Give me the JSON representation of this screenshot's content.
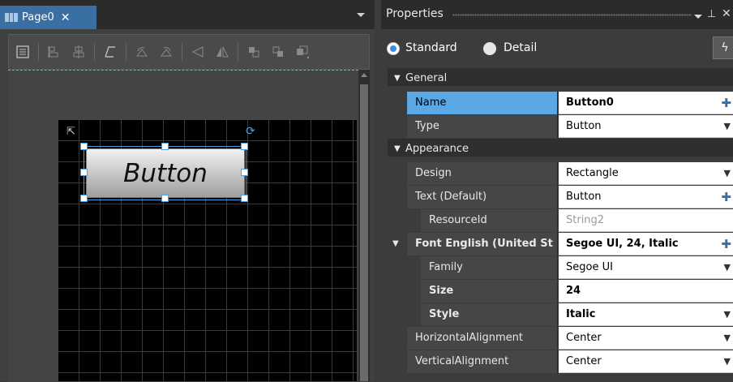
{
  "document_tab": {
    "label": "Page0",
    "close": "✕"
  },
  "toolbar_icons": [
    "page-properties-icon",
    "align-left-icon",
    "align-center-icon",
    "skew-icon",
    "rotate-left-icon",
    "rotate-right-icon",
    "flip-horizontal-icon",
    "flip-vertical-icon",
    "bring-forward-icon",
    "send-backward-icon",
    "bring-to-front-icon"
  ],
  "canvas": {
    "button_text": "Button"
  },
  "properties": {
    "title": "Properties",
    "pin": "ꟷ",
    "close": "✕",
    "mode": {
      "standard": "Standard",
      "detail": "Detail",
      "selected": "standard"
    },
    "lightning": "ϟ",
    "rows": [
      {
        "kind": "category",
        "label": "General"
      },
      {
        "kind": "prop",
        "name": "Name",
        "value": "Button0",
        "selected": true,
        "bold_value": true,
        "control": "plus"
      },
      {
        "kind": "prop",
        "name": "Type",
        "value": "Button",
        "control": "dropdown"
      },
      {
        "kind": "category",
        "label": "Appearance"
      },
      {
        "kind": "prop",
        "name": "Design",
        "value": "Rectangle",
        "control": "dropdown"
      },
      {
        "kind": "prop",
        "name": "Text (Default)",
        "value": "Button",
        "control": "plus"
      },
      {
        "kind": "prop",
        "name": "ResourceId",
        "value": "String2",
        "indent": 1,
        "dim": true
      },
      {
        "kind": "subcat",
        "name": "Font English (United St",
        "value": "Segoe UI, 24, Italic",
        "bold_name": true,
        "bold_value": true,
        "control": "plus"
      },
      {
        "kind": "prop",
        "name": "Family",
        "value": "Segoe UI",
        "indent": 1,
        "control": "dropdown"
      },
      {
        "kind": "prop",
        "name": "Size",
        "value": "24",
        "indent": 1,
        "bold_name": true,
        "bold_value": true
      },
      {
        "kind": "prop",
        "name": "Style",
        "value": "Italic",
        "indent": 1,
        "bold_name": true,
        "bold_value": true,
        "control": "dropdown"
      },
      {
        "kind": "prop",
        "name": "HorizontalAlignment",
        "value": "Center",
        "control": "dropdown"
      },
      {
        "kind": "prop",
        "name": "VerticalAlignment",
        "value": "Center",
        "control": "dropdown"
      }
    ]
  },
  "colors": {
    "accent": "#3a6fa3",
    "selection": "#5aa8e6",
    "handle": "#4aa0e0"
  }
}
